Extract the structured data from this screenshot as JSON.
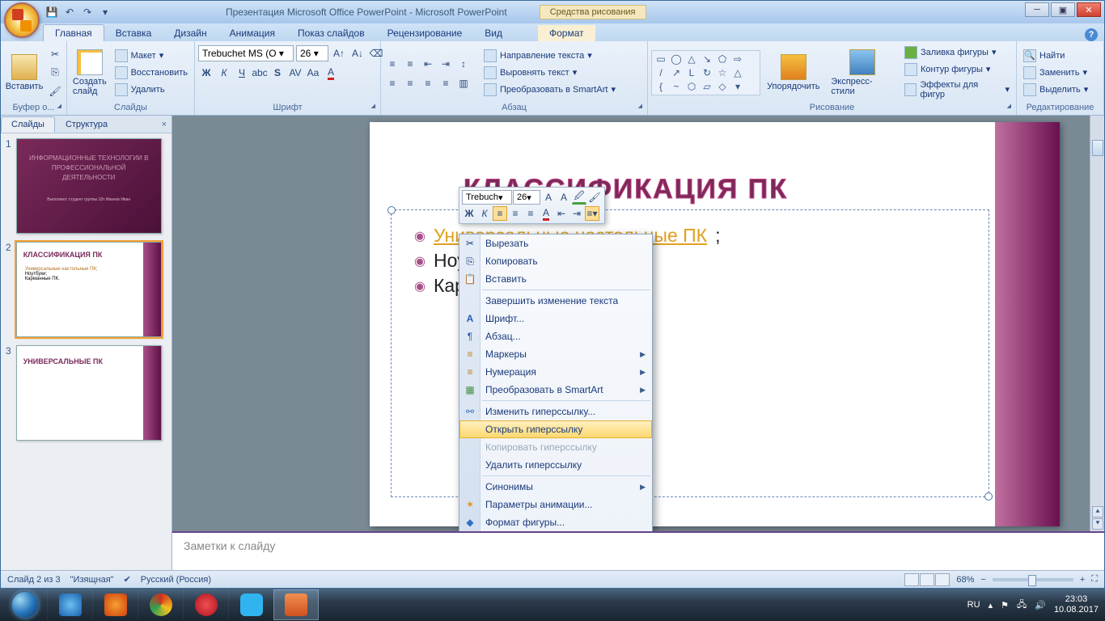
{
  "titlebar": {
    "title": "Презентация Microsoft Office PowerPoint - Microsoft PowerPoint",
    "context_tab": "Средства рисования"
  },
  "ribbon_tabs": [
    "Главная",
    "Вставка",
    "Дизайн",
    "Анимация",
    "Показ слайдов",
    "Рецензирование",
    "Вид",
    "Формат"
  ],
  "ribbon": {
    "clipboard": {
      "label": "Буфер о...",
      "paste": "Вставить"
    },
    "slides": {
      "label": "Слайды",
      "new": "Создать слайд",
      "layout": "Макет",
      "reset": "Восстановить",
      "delete": "Удалить"
    },
    "font": {
      "label": "Шрифт",
      "name": "Trebuchet MS (О",
      "size": "26"
    },
    "paragraph": {
      "label": "Абзац",
      "dir": "Направление текста",
      "align": "Выровнять текст",
      "smartart": "Преобразовать в SmartArt"
    },
    "drawing": {
      "label": "Рисование",
      "arrange": "Упорядочить",
      "quick": "Экспресс-стили",
      "fill": "Заливка фигуры",
      "outline": "Контур фигуры",
      "effects": "Эффекты для фигур"
    },
    "editing": {
      "label": "Редактирование",
      "find": "Найти",
      "replace": "Заменить",
      "select": "Выделить"
    }
  },
  "slide_panel": {
    "tabs": [
      "Слайды",
      "Структура"
    ],
    "slides": [
      {
        "n": "1",
        "title": "ИНФОРМАЦИОННЫЕ ТЕХНОЛОГИИ В ПРОФЕССИОНАЛЬНОЙ ДЕЯТЕЛЬНОСТИ",
        "sub": "Выполнил: студент группы 18т Иванов Иван"
      },
      {
        "n": "2",
        "title": "КЛАССИФИКАЦИЯ ПК",
        "bullets": [
          "Универсальные настольные ПК;",
          "Ноутбуки;",
          "Карманные ПК."
        ]
      },
      {
        "n": "3",
        "title": "УНИВЕРСАЛЬНЫЕ  ПК"
      }
    ],
    "selected": 1
  },
  "slide": {
    "title": "КЛАССИФИКАЦИЯ ПК",
    "bullets": [
      "Универсальные настольные ПК",
      "Ноутб",
      "Карм"
    ]
  },
  "minitoolbar": {
    "font": "Trebuch",
    "size": "26"
  },
  "context_menu": [
    {
      "icon": "✂",
      "label": "Вырезать"
    },
    {
      "icon": "⎘",
      "label": "Копировать"
    },
    {
      "icon": "📋",
      "label": "Вставить"
    },
    {
      "sep": true
    },
    {
      "icon": "",
      "label": "Завершить изменение текста"
    },
    {
      "icon": "A",
      "label": "Шрифт..."
    },
    {
      "icon": "¶",
      "label": "Абзац..."
    },
    {
      "icon": "≡",
      "label": "Маркеры",
      "sub": true
    },
    {
      "icon": "≡",
      "label": "Нумерация",
      "sub": true
    },
    {
      "icon": "▦",
      "label": "Преобразовать в SmartArt",
      "sub": true
    },
    {
      "sep": true
    },
    {
      "icon": "🔗",
      "label": "Изменить гиперссылку..."
    },
    {
      "icon": "",
      "label": "Открыть гиперссылку",
      "hl": true
    },
    {
      "icon": "",
      "label": "Копировать гиперссылку",
      "dis": true
    },
    {
      "icon": "",
      "label": "Удалить гиперссылку"
    },
    {
      "sep": true
    },
    {
      "icon": "",
      "label": "Синонимы",
      "sub": true
    },
    {
      "icon": "✶",
      "label": "Параметры анимации..."
    },
    {
      "icon": "◆",
      "label": "Формат фигуры..."
    }
  ],
  "notes_placeholder": "Заметки к слайду",
  "statusbar": {
    "slide_pos": "Слайд 2 из 3",
    "theme": "\"Изящная\"",
    "lang": "Русский (Россия)",
    "zoom": "68%"
  },
  "taskbar": {
    "lang": "RU",
    "time": "23:03",
    "date": "10.08.2017"
  }
}
